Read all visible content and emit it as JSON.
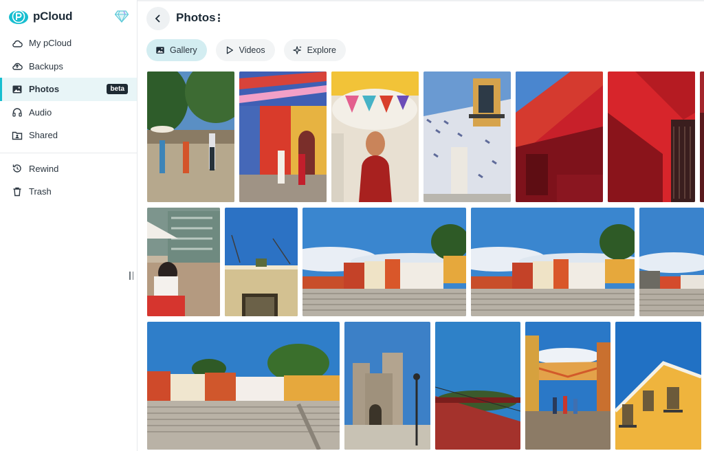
{
  "app": {
    "logo_text": "pCloud"
  },
  "sidebar": {
    "items": [
      {
        "label": "My pCloud",
        "icon": "cloud-icon"
      },
      {
        "label": "Backups",
        "icon": "cloud-upload-icon"
      },
      {
        "label": "Photos",
        "icon": "image-icon",
        "badge": "beta",
        "active": true
      },
      {
        "label": "Audio",
        "icon": "headphones-icon"
      },
      {
        "label": "Shared",
        "icon": "shared-folder-icon"
      },
      {
        "label": "Rewind",
        "icon": "rewind-icon"
      },
      {
        "label": "Trash",
        "icon": "trash-icon"
      }
    ]
  },
  "header": {
    "title": "Photos"
  },
  "tabs": [
    {
      "label": "Gallery",
      "icon": "image-icon",
      "active": true
    },
    {
      "label": "Videos",
      "icon": "play-icon"
    },
    {
      "label": "Explore",
      "icon": "sparkle-icon"
    }
  ],
  "gallery": {
    "photos": [
      {
        "subject": "street-with-people",
        "colors": [
          "#4f7fb0",
          "#2f5a2a",
          "#b9a98c"
        ]
      },
      {
        "subject": "colorful-street-papel-picado",
        "colors": [
          "#3a58a6",
          "#d3422e",
          "#e8b43c"
        ]
      },
      {
        "subject": "woman-with-hat",
        "colors": [
          "#e9e3d9",
          "#a6251f",
          "#f0c13c"
        ]
      },
      {
        "subject": "white-wall-balcony",
        "colors": [
          "#5d92cf",
          "#dcdfe8",
          "#c4502a"
        ]
      },
      {
        "subject": "red-wall-shadow",
        "colors": [
          "#4d85d0",
          "#c7212a",
          "#7d1118"
        ]
      },
      {
        "subject": "red-wall-window",
        "colors": [
          "#d5252a",
          "#8a141b",
          "#3b1f1f"
        ]
      },
      {
        "subject": "woman-in-plaza",
        "colors": [
          "#8aa69c",
          "#c9b9a3",
          "#c8342f"
        ]
      },
      {
        "subject": "blue-sky-building-top",
        "colors": [
          "#2f74c7",
          "#d5c49a",
          "#3a3323"
        ]
      },
      {
        "subject": "plaza-steps-wide",
        "colors": [
          "#3c86cf",
          "#c66a2f",
          "#b7b1a6"
        ]
      },
      {
        "subject": "plaza-steps-wide-2",
        "colors": [
          "#3c86cf",
          "#c66a2f",
          "#b7b1a6"
        ]
      },
      {
        "subject": "plaza-steps-edge",
        "colors": [
          "#3a83cc",
          "#d44b2c",
          "#b5aea3"
        ]
      },
      {
        "subject": "plaza-steps-yellow",
        "colors": [
          "#2f7ec9",
          "#e6a83d",
          "#b9b2a6"
        ]
      },
      {
        "subject": "church",
        "colors": [
          "#3c80c7",
          "#a99b87",
          "#6b6456"
        ]
      },
      {
        "subject": "red-roof-sky",
        "colors": [
          "#2e81c8",
          "#a4322c",
          "#2f4f2a"
        ]
      },
      {
        "subject": "street-canopy",
        "colors": [
          "#2a78c7",
          "#e3a24a",
          "#8c7b66"
        ]
      },
      {
        "subject": "yellow-building",
        "colors": [
          "#2171c4",
          "#efb43d",
          "#6c5a3a"
        ]
      }
    ]
  }
}
